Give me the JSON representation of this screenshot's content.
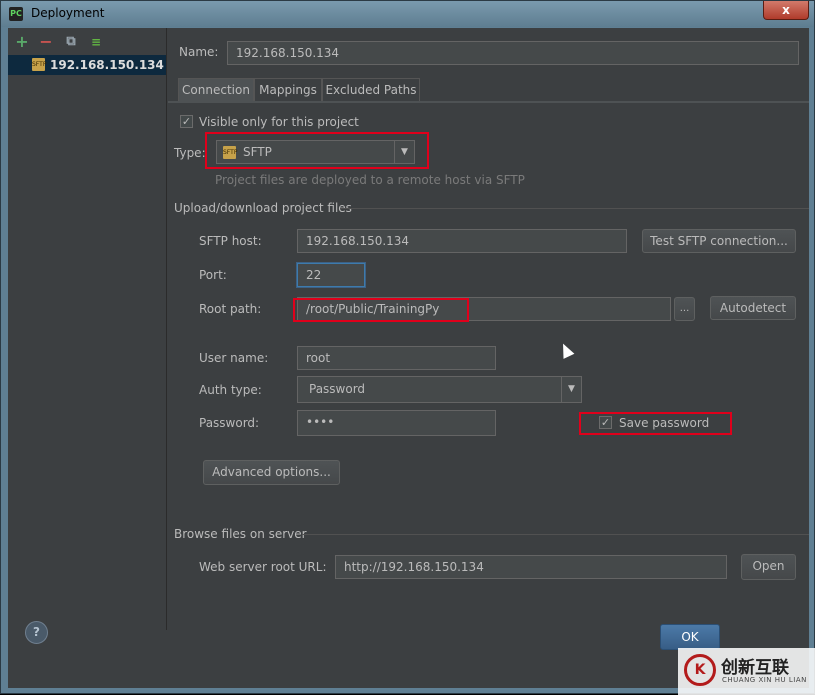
{
  "window": {
    "title": "Deployment",
    "close_glyph": "x",
    "app_icon_text": "PC"
  },
  "sidebar": {
    "toolbar": [
      {
        "icon": "plus-icon",
        "glyph": "+"
      },
      {
        "icon": "minus-icon",
        "glyph": "−"
      },
      {
        "icon": "copy-icon",
        "glyph": "⧉"
      },
      {
        "icon": "move-icon",
        "glyph": "≡"
      }
    ],
    "servers": [
      {
        "label": "192.168.150.134",
        "icon": "sftp-icon",
        "icon_text": "SFTP"
      }
    ]
  },
  "name_field": {
    "label": "Name:",
    "value": "192.168.150.134"
  },
  "tabs": [
    {
      "label": "Connection",
      "active": true
    },
    {
      "label": "Mappings",
      "active": false
    },
    {
      "label": "Excluded Paths",
      "active": false
    }
  ],
  "connection": {
    "visible_only": {
      "label": "Visible only for this project",
      "checked": true,
      "check": "✓"
    },
    "type": {
      "label": "Type:",
      "value": "SFTP",
      "icon_text": "SFTP",
      "hint": "Project files are deployed to a remote host via SFTP"
    },
    "upload_section": {
      "title": "Upload/download project files"
    },
    "sftp_host": {
      "label": "SFTP host:",
      "value": "192.168.150.134",
      "test_button": "Test SFTP connection..."
    },
    "port": {
      "label": "Port:",
      "value": "22"
    },
    "root_path": {
      "label": "Root path:",
      "value": "/root/Public/TrainingPy",
      "browse_button": "...",
      "autodetect_button": "Autodetect"
    },
    "user_name": {
      "label": "User name:",
      "value": "root"
    },
    "auth_type": {
      "label": "Auth type:",
      "value": "Password"
    },
    "password": {
      "label": "Password:",
      "value": "••••"
    },
    "save_password": {
      "label": "Save password",
      "checked": true,
      "check": "✓"
    },
    "advanced_button": "Advanced options...",
    "browse_section": {
      "title": "Browse files on server"
    },
    "web_root": {
      "label": "Web server root URL:",
      "value": "http://192.168.150.134",
      "open_button": "Open"
    }
  },
  "footer": {
    "help": "?",
    "ok_button": "OK"
  },
  "watermark": {
    "logo_text": "K",
    "text": "创新互联",
    "subtext": "CHUANG XIN HU LIAN"
  },
  "colors": {
    "highlight_box": "#e0001b",
    "selection": "#0d293e",
    "panel": "#3c3f41"
  }
}
